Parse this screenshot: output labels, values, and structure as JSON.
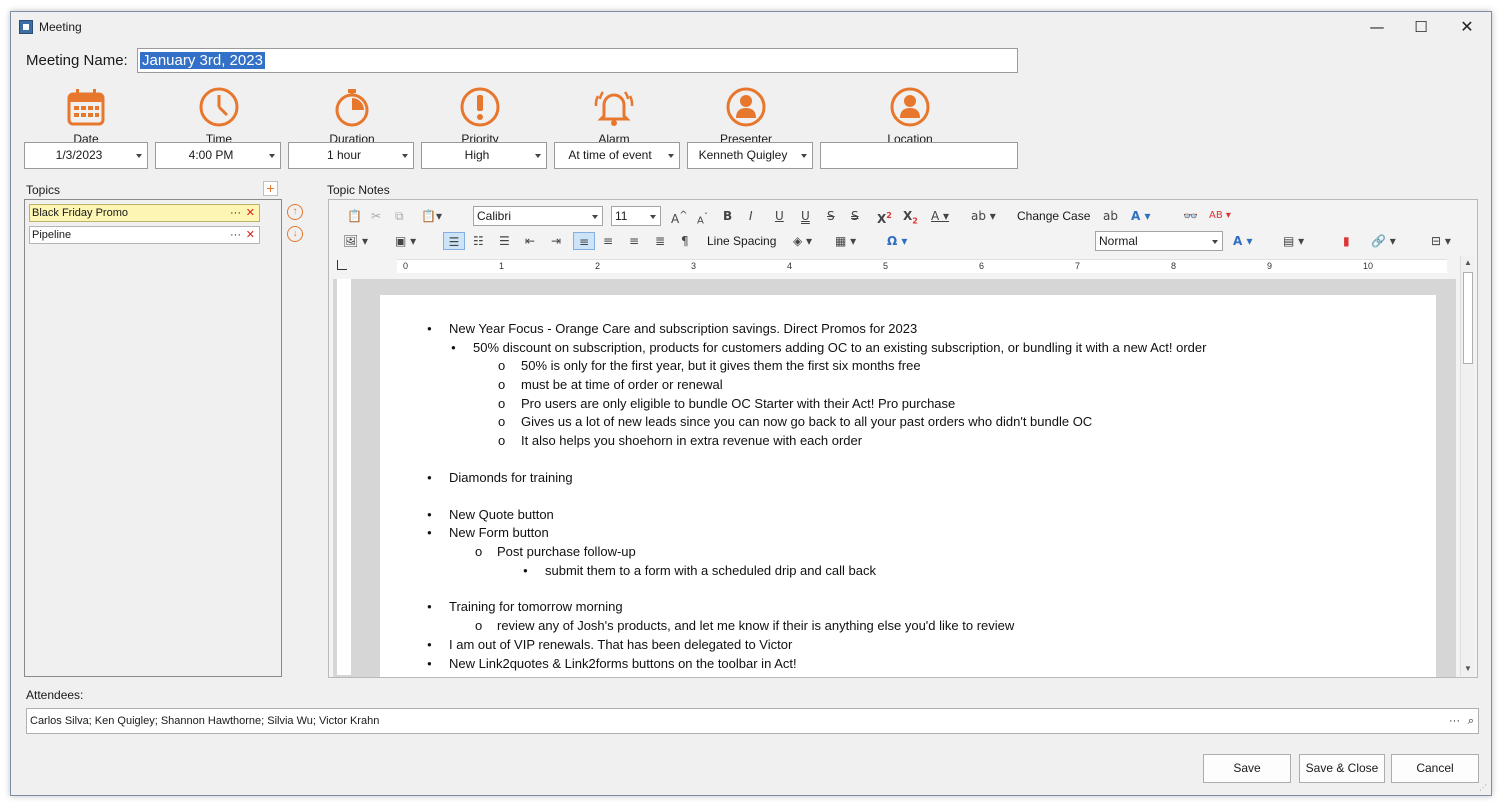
{
  "window": {
    "title": "Meeting",
    "minimize": "—",
    "maximize": "☐",
    "close": "✕"
  },
  "meeting": {
    "label": "Meeting Name:",
    "value": "January 3rd, 2023"
  },
  "fields": {
    "date": {
      "caption": "Date",
      "value": "1/3/2023"
    },
    "time": {
      "caption": "Time",
      "value": "4:00 PM"
    },
    "duration": {
      "caption": "Duration",
      "value": "1 hour"
    },
    "priority": {
      "caption": "Priority",
      "value": "High"
    },
    "alarm": {
      "caption": "Alarm",
      "value": "At time of event"
    },
    "presenter": {
      "caption": "Presenter",
      "value": "Kenneth Quigley"
    },
    "location": {
      "caption": "Location",
      "value": ""
    }
  },
  "topics": {
    "label": "Topics",
    "items": [
      {
        "label": "Black Friday Promo",
        "selected": true
      },
      {
        "label": "Pipeline",
        "selected": false
      }
    ],
    "more_glyph": "···",
    "delete_glyph": "✕"
  },
  "notes": {
    "label": "Topic Notes",
    "toolbar": {
      "font": "Calibri",
      "size": "11",
      "change_case": "Change Case",
      "line_spacing": "Line Spacing",
      "style": "Normal"
    },
    "ruler_numbers": [
      "0",
      "1",
      "2",
      "3",
      "4",
      "5",
      "6",
      "7",
      "8",
      "9",
      "10"
    ],
    "lines": [
      {
        "text": "New Year Focus - Orange Care and subscription savings. Direct Promos for 2023",
        "level": 0
      },
      {
        "text": "50% discount on subscription, products for customers adding OC to an existing subscription, or bundling it with a new Act! order",
        "level": 1
      },
      {
        "text": "50% is only for the first year, but it gives them the first six months free",
        "level": 2
      },
      {
        "text": "must be at time of order or renewal",
        "level": 2
      },
      {
        "text": "Pro users are only eligible to bundle OC Starter with their Act! Pro purchase",
        "level": 2
      },
      {
        "text": "Gives us a lot of new leads since you can now go back to all your past orders who didn't bundle OC",
        "level": 2
      },
      {
        "text": "It also helps you shoehorn in extra revenue with each order",
        "level": 2
      },
      {
        "text": "Diamonds for training",
        "level": 0
      },
      {
        "text": "New Quote button",
        "level": 0
      },
      {
        "text": "New Form button",
        "level": 0
      },
      {
        "text": "Post purchase follow-up",
        "level": 1
      },
      {
        "text": "submit them to a form with a scheduled drip and call back",
        "level": 2
      },
      {
        "text": "Training for tomorrow morning",
        "level": 0
      },
      {
        "text": "review any of Josh's products, and let me know if their is anything else you'd like to review",
        "level": 1
      },
      {
        "text": "I am out of VIP renewals. That has been delegated to Victor",
        "level": 0
      },
      {
        "text": "New Link2quotes & Link2forms buttons on the toolbar in Act!",
        "level": 0
      }
    ]
  },
  "attendees": {
    "label": "Attendees:",
    "value": "Carlos Silva; Ken Quigley; Shannon Hawthorne; Silvia Wu; Victor Krahn"
  },
  "buttons": {
    "save": "Save",
    "save_close": "Save & Close",
    "cancel": "Cancel"
  },
  "colors": {
    "accent": "#e8772e",
    "selection": "#3370c7",
    "topic_selected": "#fcf5b4"
  }
}
